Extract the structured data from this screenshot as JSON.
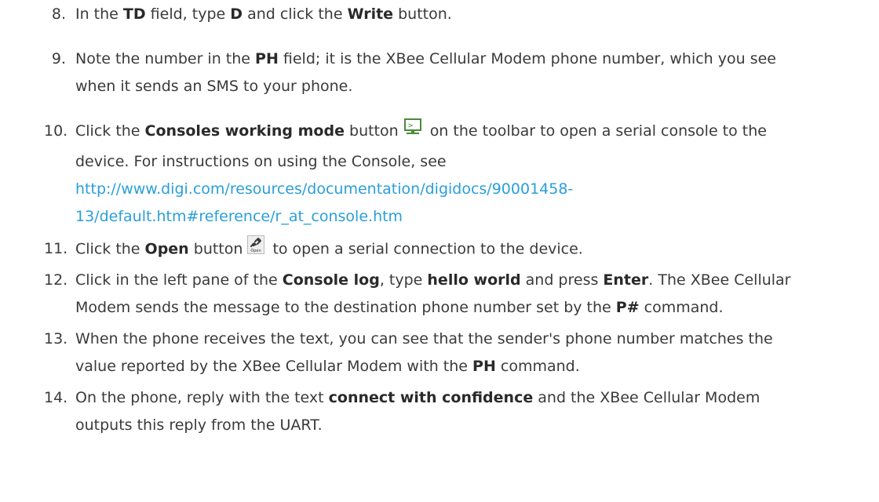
{
  "steps": [
    {
      "number": "8.",
      "lines": [
        [
          "In the ",
          {
            "b": "TD"
          },
          " field, type ",
          {
            "b": "D"
          },
          " and click the ",
          {
            "b": "Write"
          },
          " button."
        ]
      ]
    },
    {
      "number": "9.",
      "lines": [
        [
          "Note the number in the ",
          {
            "b": "PH"
          },
          " field; it is the XBee Cellular Modem phone number, which you see"
        ],
        [
          "when it sends an SMS to your phone."
        ]
      ]
    },
    {
      "number": "10.",
      "lines": [
        [
          "Click the ",
          {
            "b": "Consoles working mode"
          },
          " button",
          {
            "icon": "consoles-working-mode-icon"
          },
          "on the toolbar to open a serial console to the"
        ],
        [
          "device. For instructions on using the Console, see"
        ],
        [
          {
            "link": "http://www.digi.com/resources/documentation/digidocs/90001458-"
          }
        ],
        [
          {
            "link": "13/default.htm#reference/r_at_console.htm"
          }
        ]
      ]
    },
    {
      "number": "11.",
      "lines": [
        [
          "Click the ",
          {
            "b": "Open"
          },
          " button",
          {
            "icon": "open-connection-icon"
          },
          "to open a serial connection to the device."
        ]
      ]
    },
    {
      "number": "12.",
      "lines": [
        [
          "Click in the left pane of the ",
          {
            "b": "Console log"
          },
          ", type ",
          {
            "b": "hello world"
          },
          " and press ",
          {
            "b": "Enter"
          },
          ". The XBee Cellular"
        ],
        [
          "Modem sends the message to the destination phone number set by the ",
          {
            "b": "P#"
          },
          " command."
        ]
      ]
    },
    {
      "number": "13.",
      "lines": [
        [
          "When the phone receives the text, you can see that the sender's phone number matches the"
        ],
        [
          "value reported by the XBee Cellular Modem with the ",
          {
            "b": "PH"
          },
          " command."
        ]
      ]
    },
    {
      "number": "14.",
      "lines": [
        [
          "On the phone, reply with the text ",
          {
            "b": "connect with confidence"
          },
          " and the XBee Cellular Modem"
        ],
        [
          "outputs this reply from the UART."
        ]
      ]
    }
  ],
  "icons": {
    "open_icon_caption": "Open",
    "console_icon_glyph": ">"
  },
  "colors": {
    "text": "#3a3a3a",
    "bold": "#2a2a2a",
    "link": "#2a9fd8",
    "icon_green": "#4a8a3a"
  }
}
